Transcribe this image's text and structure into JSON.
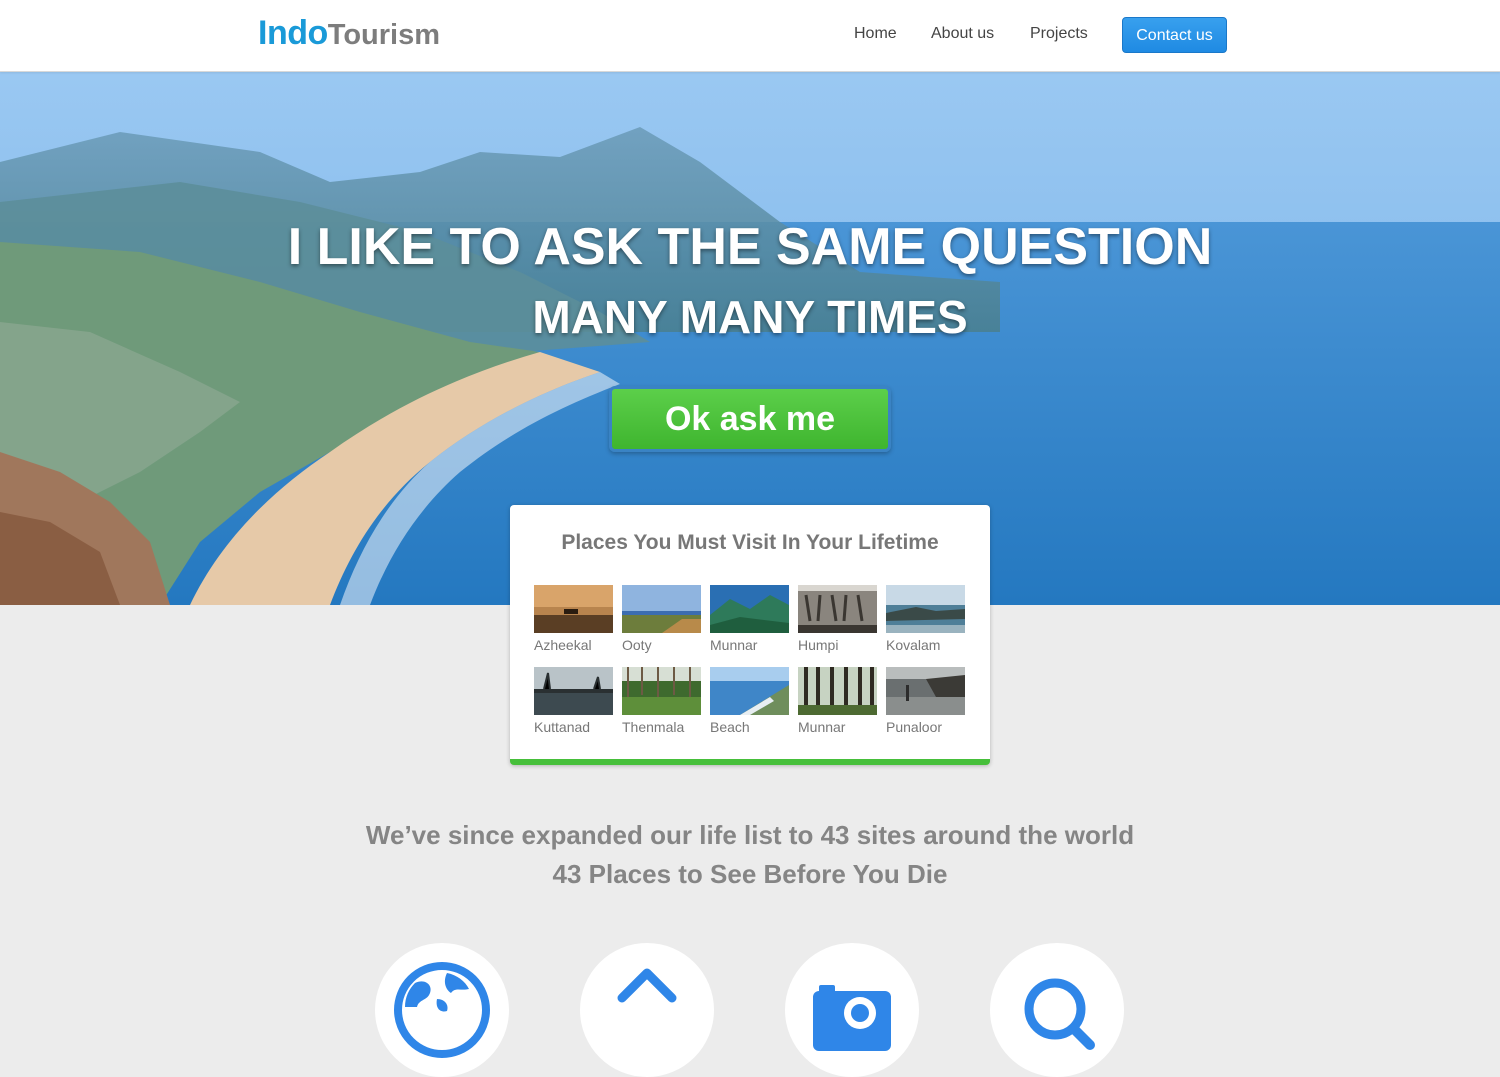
{
  "header": {
    "logo_part1": "Indo",
    "logo_part2": "Tourism",
    "nav": {
      "home": "Home",
      "about": "About us",
      "projects": "Projects",
      "contact": "Contact us"
    }
  },
  "hero": {
    "line1": "I LIKE TO ASK THE SAME QUESTION",
    "line2": "MANY MANY TIMES",
    "cta_label": "Ok ask me"
  },
  "places_card": {
    "title": "Places You Must Visit In Your Lifetime",
    "places": [
      {
        "name": "Azheekal"
      },
      {
        "name": "Ooty"
      },
      {
        "name": "Munnar"
      },
      {
        "name": "Humpi"
      },
      {
        "name": "Kovalam"
      },
      {
        "name": "Kuttanad"
      },
      {
        "name": "Thenmala"
      },
      {
        "name": "Beach"
      },
      {
        "name": "Munnar"
      },
      {
        "name": "Punaloor"
      }
    ]
  },
  "tagline": {
    "line1": "We’ve since expanded our life list to 43 sites around the world",
    "line2": "43 Places to See Before You Die"
  },
  "features": [
    {
      "icon": "globe-icon"
    },
    {
      "icon": "home-icon"
    },
    {
      "icon": "camera-icon"
    },
    {
      "icon": "search-icon"
    }
  ],
  "colors": {
    "brand_blue": "#1a9ad8",
    "cta_green": "#46bf3a",
    "feature_icon_blue": "#2f86e8"
  }
}
